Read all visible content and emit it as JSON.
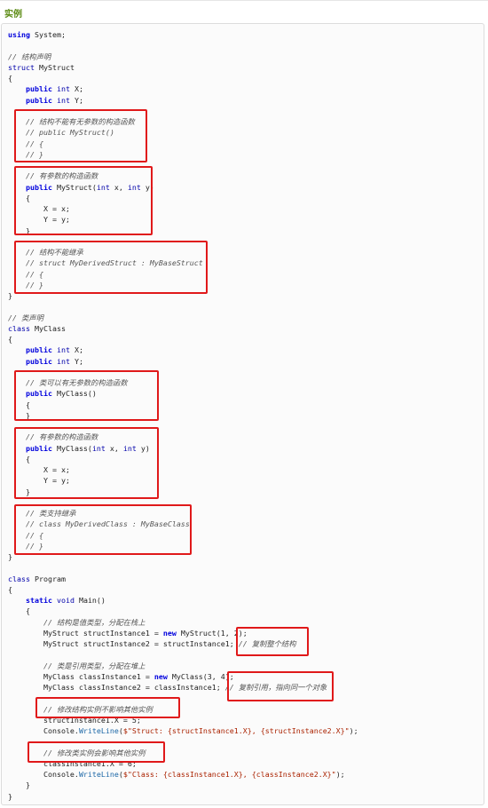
{
  "section": {
    "title": "实例"
  },
  "code_lines": [
    {
      "parts": [
        {
          "t": "using",
          "c": "kw"
        },
        {
          "t": " System;",
          "c": ""
        }
      ]
    },
    {
      "parts": []
    },
    {
      "parts": [
        {
          "t": "// 结构声明",
          "c": "cm"
        }
      ]
    },
    {
      "parts": [
        {
          "t": "struct",
          "c": "kw2"
        },
        {
          "t": " MyStruct",
          "c": ""
        }
      ]
    },
    {
      "parts": [
        {
          "t": "{",
          "c": ""
        }
      ]
    },
    {
      "parts": [
        {
          "t": "    ",
          "c": ""
        },
        {
          "t": "public",
          "c": "kw"
        },
        {
          "t": " ",
          "c": ""
        },
        {
          "t": "int",
          "c": "kw2"
        },
        {
          "t": " X;",
          "c": ""
        }
      ]
    },
    {
      "parts": [
        {
          "t": "    ",
          "c": ""
        },
        {
          "t": "public",
          "c": "kw"
        },
        {
          "t": " ",
          "c": ""
        },
        {
          "t": "int",
          "c": "kw2"
        },
        {
          "t": " Y;",
          "c": ""
        }
      ]
    },
    {
      "parts": []
    },
    {
      "parts": [
        {
          "t": "    // 结构不能有无参数的构造函数",
          "c": "cm"
        }
      ]
    },
    {
      "parts": [
        {
          "t": "    // public MyStruct()",
          "c": "cm"
        }
      ]
    },
    {
      "parts": [
        {
          "t": "    // {",
          "c": "cm"
        }
      ]
    },
    {
      "parts": [
        {
          "t": "    // }",
          "c": "cm"
        }
      ]
    },
    {
      "parts": []
    },
    {
      "parts": [
        {
          "t": "    // 有参数的构造函数",
          "c": "cm"
        }
      ]
    },
    {
      "parts": [
        {
          "t": "    ",
          "c": ""
        },
        {
          "t": "public",
          "c": "kw"
        },
        {
          "t": " MyStruct(",
          "c": ""
        },
        {
          "t": "int",
          "c": "kw2"
        },
        {
          "t": " x, ",
          "c": ""
        },
        {
          "t": "int",
          "c": "kw2"
        },
        {
          "t": " y)",
          "c": ""
        }
      ]
    },
    {
      "parts": [
        {
          "t": "    {",
          "c": ""
        }
      ]
    },
    {
      "parts": [
        {
          "t": "        X = x;",
          "c": ""
        }
      ]
    },
    {
      "parts": [
        {
          "t": "        Y = y;",
          "c": ""
        }
      ]
    },
    {
      "parts": [
        {
          "t": "    }",
          "c": ""
        }
      ]
    },
    {
      "parts": []
    },
    {
      "parts": [
        {
          "t": "    // 结构不能继承",
          "c": "cm"
        }
      ]
    },
    {
      "parts": [
        {
          "t": "    // struct MyDerivedStruct : MyBaseStruct",
          "c": "cm"
        }
      ]
    },
    {
      "parts": [
        {
          "t": "    // {",
          "c": "cm"
        }
      ]
    },
    {
      "parts": [
        {
          "t": "    // }",
          "c": "cm"
        }
      ]
    },
    {
      "parts": [
        {
          "t": "}",
          "c": ""
        }
      ]
    },
    {
      "parts": []
    },
    {
      "parts": [
        {
          "t": "// 类声明",
          "c": "cm"
        }
      ]
    },
    {
      "parts": [
        {
          "t": "class",
          "c": "kw2"
        },
        {
          "t": " MyClass",
          "c": ""
        }
      ]
    },
    {
      "parts": [
        {
          "t": "{",
          "c": ""
        }
      ]
    },
    {
      "parts": [
        {
          "t": "    ",
          "c": ""
        },
        {
          "t": "public",
          "c": "kw"
        },
        {
          "t": " ",
          "c": ""
        },
        {
          "t": "int",
          "c": "kw2"
        },
        {
          "t": " X;",
          "c": ""
        }
      ]
    },
    {
      "parts": [
        {
          "t": "    ",
          "c": ""
        },
        {
          "t": "public",
          "c": "kw"
        },
        {
          "t": " ",
          "c": ""
        },
        {
          "t": "int",
          "c": "kw2"
        },
        {
          "t": " Y;",
          "c": ""
        }
      ]
    },
    {
      "parts": []
    },
    {
      "parts": [
        {
          "t": "    // 类可以有无参数的构造函数",
          "c": "cm"
        }
      ]
    },
    {
      "parts": [
        {
          "t": "    ",
          "c": ""
        },
        {
          "t": "public",
          "c": "kw"
        },
        {
          "t": " MyClass()",
          "c": ""
        }
      ]
    },
    {
      "parts": [
        {
          "t": "    {",
          "c": ""
        }
      ]
    },
    {
      "parts": [
        {
          "t": "    }",
          "c": ""
        }
      ]
    },
    {
      "parts": []
    },
    {
      "parts": [
        {
          "t": "    // 有参数的构造函数",
          "c": "cm"
        }
      ]
    },
    {
      "parts": [
        {
          "t": "    ",
          "c": ""
        },
        {
          "t": "public",
          "c": "kw"
        },
        {
          "t": " MyClass(",
          "c": ""
        },
        {
          "t": "int",
          "c": "kw2"
        },
        {
          "t": " x, ",
          "c": ""
        },
        {
          "t": "int",
          "c": "kw2"
        },
        {
          "t": " y)",
          "c": ""
        }
      ]
    },
    {
      "parts": [
        {
          "t": "    {",
          "c": ""
        }
      ]
    },
    {
      "parts": [
        {
          "t": "        X = x;",
          "c": ""
        }
      ]
    },
    {
      "parts": [
        {
          "t": "        Y = y;",
          "c": ""
        }
      ]
    },
    {
      "parts": [
        {
          "t": "    }",
          "c": ""
        }
      ]
    },
    {
      "parts": []
    },
    {
      "parts": [
        {
          "t": "    // 类支持继承",
          "c": "cm"
        }
      ]
    },
    {
      "parts": [
        {
          "t": "    // class MyDerivedClass : MyBaseClass",
          "c": "cm"
        }
      ]
    },
    {
      "parts": [
        {
          "t": "    // {",
          "c": "cm"
        }
      ]
    },
    {
      "parts": [
        {
          "t": "    // }",
          "c": "cm"
        }
      ]
    },
    {
      "parts": [
        {
          "t": "}",
          "c": ""
        }
      ]
    },
    {
      "parts": []
    },
    {
      "parts": [
        {
          "t": "class",
          "c": "kw2"
        },
        {
          "t": " Program",
          "c": ""
        }
      ]
    },
    {
      "parts": [
        {
          "t": "{",
          "c": ""
        }
      ]
    },
    {
      "parts": [
        {
          "t": "    ",
          "c": ""
        },
        {
          "t": "static",
          "c": "kw"
        },
        {
          "t": " ",
          "c": ""
        },
        {
          "t": "void",
          "c": "kw2"
        },
        {
          "t": " Main()",
          "c": ""
        }
      ]
    },
    {
      "parts": [
        {
          "t": "    {",
          "c": ""
        }
      ]
    },
    {
      "parts": [
        {
          "t": "        // 结构是值类型，分配在栈上",
          "c": "cm"
        }
      ]
    },
    {
      "parts": [
        {
          "t": "        MyStruct structInstance1 = ",
          "c": ""
        },
        {
          "t": "new",
          "c": "kw"
        },
        {
          "t": " MyStruct(1, 2);",
          "c": ""
        }
      ]
    },
    {
      "parts": [
        {
          "t": "        MyStruct structInstance2 = structInstance1; ",
          "c": ""
        },
        {
          "t": "// 复制整个结构",
          "c": "cm"
        }
      ]
    },
    {
      "parts": []
    },
    {
      "parts": [
        {
          "t": "        // 类是引用类型，分配在堆上",
          "c": "cm"
        }
      ]
    },
    {
      "parts": [
        {
          "t": "        MyClass classInstance1 = ",
          "c": ""
        },
        {
          "t": "new",
          "c": "kw"
        },
        {
          "t": " MyClass(3, 4);",
          "c": ""
        }
      ]
    },
    {
      "parts": [
        {
          "t": "        MyClass classInstance2 = classInstance1; ",
          "c": ""
        },
        {
          "t": "// 复制引用，指向同一个对象",
          "c": "cm"
        }
      ]
    },
    {
      "parts": []
    },
    {
      "parts": [
        {
          "t": "        // 修改结构实例不影响其他实例",
          "c": "cm"
        }
      ]
    },
    {
      "parts": [
        {
          "t": "        structInstance1.X = 5;",
          "c": ""
        }
      ]
    },
    {
      "parts": [
        {
          "t": "        Console.",
          "c": ""
        },
        {
          "t": "WriteLine",
          "c": "fn"
        },
        {
          "t": "(",
          "c": ""
        },
        {
          "t": "$\"Struct: {structInstance1.X}, {structInstance2.X}\"",
          "c": "str"
        },
        {
          "t": ");",
          "c": ""
        }
      ]
    },
    {
      "parts": []
    },
    {
      "parts": [
        {
          "t": "        // 修改类实例会影响其他实例",
          "c": "cm"
        }
      ]
    },
    {
      "parts": [
        {
          "t": "        classInstance1.X = 6;",
          "c": ""
        }
      ]
    },
    {
      "parts": [
        {
          "t": "        Console.",
          "c": ""
        },
        {
          "t": "WriteLine",
          "c": "fn"
        },
        {
          "t": "(",
          "c": ""
        },
        {
          "t": "$\"Class: {classInstance1.X}, {classInstance2.X}\"",
          "c": "str"
        },
        {
          "t": ");",
          "c": ""
        }
      ]
    },
    {
      "parts": [
        {
          "t": "    }",
          "c": ""
        }
      ]
    },
    {
      "parts": [
        {
          "t": "}",
          "c": ""
        }
      ]
    }
  ],
  "colors": {
    "title_green": "#5c8b14",
    "keyword_blue": "#0000dd",
    "highlight_red": "#e0191a"
  }
}
